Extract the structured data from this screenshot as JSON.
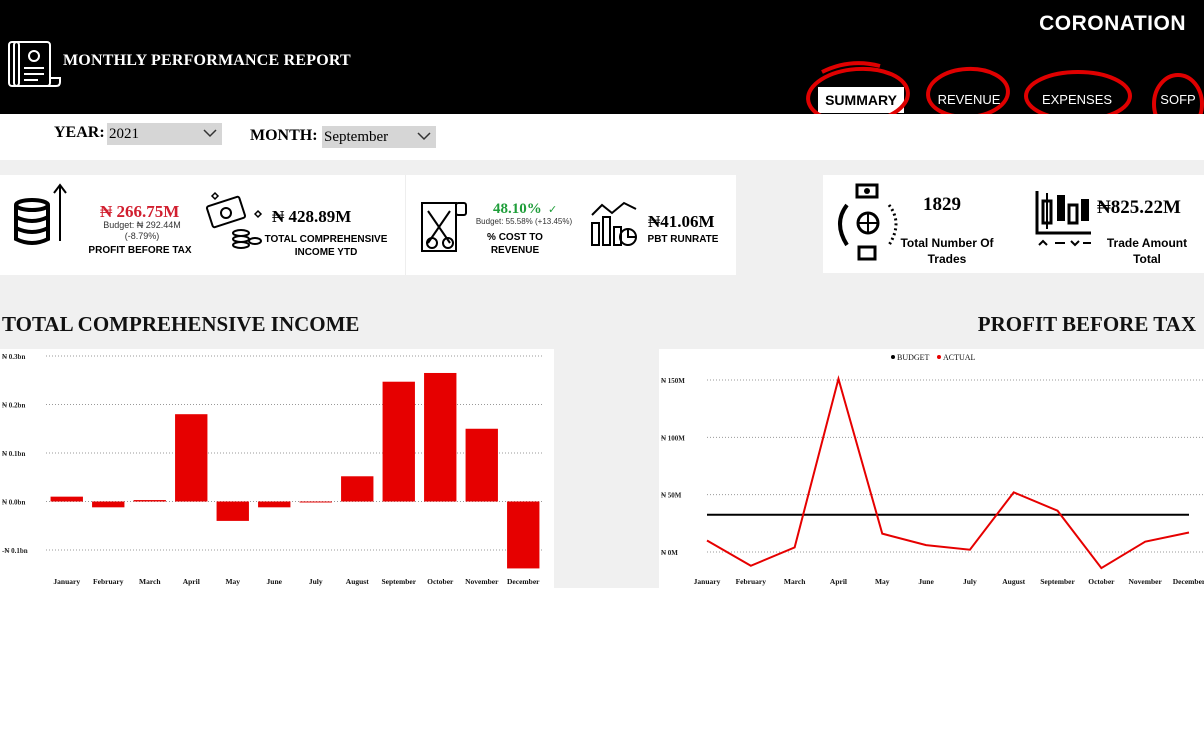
{
  "header": {
    "title": "MONTHLY PERFORMANCE REPORT",
    "brand": "CORONATION",
    "nav": [
      "SUMMARY",
      "REVENUE",
      "EXPENSES",
      "SOFP"
    ]
  },
  "filters": {
    "year_label": "YEAR:",
    "year_value": "2021",
    "month_label": "MONTH:",
    "month_value": "September"
  },
  "kpis": {
    "pbt": {
      "value": "₦ 266.75M",
      "budget": "Budget: ₦ 292.44M",
      "variance": "(-8.79%)",
      "label": "PROFIT BEFORE TAX"
    },
    "tci": {
      "value": "₦ 428.89M",
      "label1": "TOTAL COMPREHENSIVE",
      "label2": "INCOME YTD"
    },
    "cost": {
      "value": "48.10%",
      "budget": "Budget: 55.58% (+13.45%)",
      "label1": "% COST TO",
      "label2": "REVENUE"
    },
    "runrate": {
      "value": "₦41.06M",
      "label": "PBT RUNRATE"
    },
    "trades": {
      "value": "1829",
      "label1": "Total Number Of",
      "label2": "Trades"
    },
    "trade_amount": {
      "value": "₦825.22M",
      "label1": "Trade Amount",
      "label2": "Total"
    }
  },
  "colors": {
    "red": "#e60000",
    "green": "#1f9e3a",
    "kpi_red": "#d11f2f"
  },
  "chart_data": [
    {
      "type": "bar",
      "title": "TOTAL COMPREHENSIVE INCOME",
      "categories": [
        "January",
        "February",
        "March",
        "April",
        "May",
        "June",
        "July",
        "August",
        "September",
        "October",
        "November",
        "December"
      ],
      "values": [
        0.01,
        -0.012,
        0.003,
        0.18,
        -0.04,
        -0.012,
        -0.002,
        0.052,
        0.247,
        0.265,
        0.15,
        -0.138
      ],
      "yticks": [
        "₦ 0.3bn",
        "₦ 0.2bn",
        "₦ 0.1bn",
        "₦ 0.0bn",
        "-₦ 0.1bn"
      ],
      "ylim": [
        -0.1,
        0.3
      ],
      "grid": true
    },
    {
      "type": "line",
      "title": "PROFIT BEFORE TAX",
      "categories": [
        "January",
        "February",
        "March",
        "April",
        "May",
        "June",
        "July",
        "August",
        "September",
        "October",
        "November",
        "December"
      ],
      "series": [
        {
          "name": "BUDGET",
          "values": [
            32.5,
            32.5,
            32.5,
            32.5,
            32.5,
            32.5,
            32.5,
            32.5,
            32.5,
            32.5,
            32.5,
            32.5
          ]
        },
        {
          "name": "ACTUAL",
          "values": [
            10,
            -12,
            4,
            151,
            16,
            6,
            2,
            52,
            36,
            -14,
            9,
            17
          ]
        }
      ],
      "yticks": [
        "₦ 150M",
        "₦ 100M",
        "₦ 50M",
        "₦ 0M"
      ],
      "ylim": [
        0,
        150
      ],
      "legend": "top-center",
      "grid": true
    }
  ]
}
